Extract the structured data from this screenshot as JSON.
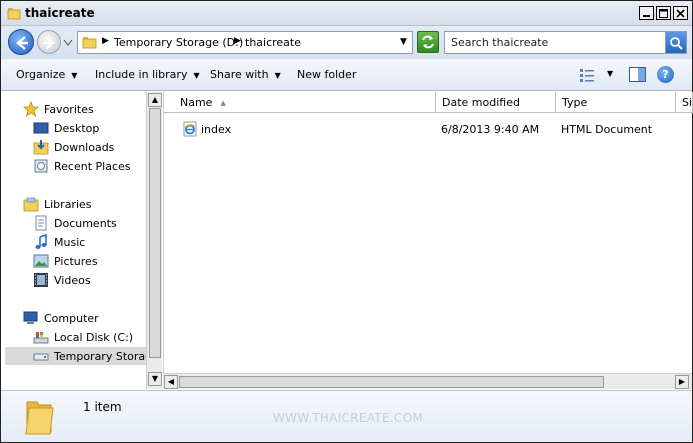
{
  "window": {
    "title": "thaicreate"
  },
  "address_bar": {
    "breadcrumbs": [
      "Temporary Storage (D:)",
      "thaicreate"
    ],
    "search_placeholder": "Search thaicreate"
  },
  "command_bar": {
    "organize": "Organize",
    "include_in_library": "Include in library",
    "share_with": "Share with",
    "new_folder": "New folder"
  },
  "nav_pane": {
    "favorites": {
      "label": "Favorites",
      "items": [
        "Desktop",
        "Downloads",
        "Recent Places"
      ]
    },
    "libraries": {
      "label": "Libraries",
      "items": [
        "Documents",
        "Music",
        "Pictures",
        "Videos"
      ]
    },
    "computer": {
      "label": "Computer",
      "items": [
        "Local Disk (C:)",
        "Temporary Storage"
      ]
    }
  },
  "file_list": {
    "columns": [
      "Name",
      "Date modified",
      "Type",
      "Si"
    ],
    "rows": [
      {
        "name": "index",
        "date_modified": "6/8/2013 9:40 AM",
        "type": "HTML Document"
      }
    ]
  },
  "details_pane": {
    "item_count": "1 item",
    "watermark": "WWW.THAICREATE.COM"
  },
  "colors": {
    "title_bar": "#d5dde8",
    "selected_nav": "#d9d9d9",
    "accent_blue": "#1d5fbf",
    "refresh_green": "#2f8a1f"
  },
  "icons": {
    "title": "folder-icon",
    "back": "back-arrow-icon",
    "forward": "forward-arrow-icon",
    "refresh": "refresh-icon",
    "search": "search-icon",
    "views": "views-icon",
    "preview_pane": "preview-pane-icon",
    "help": "help-icon",
    "file": "ie-html-document-icon"
  }
}
